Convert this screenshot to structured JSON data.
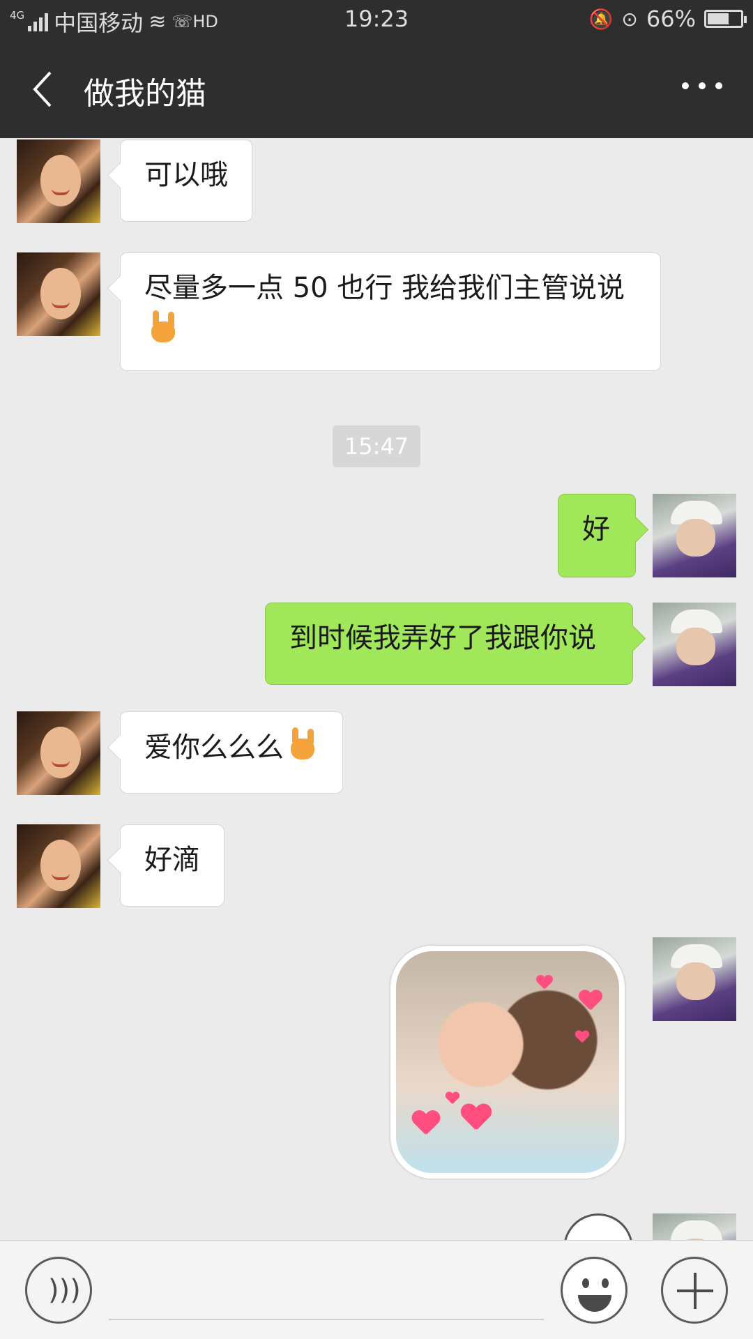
{
  "status_bar": {
    "network": "4G",
    "carrier": "中国移动",
    "call_badge": "HD",
    "time": "19:23",
    "battery": "66%",
    "battery_level": 0.66
  },
  "header": {
    "title": "做我的猫",
    "back_icon": "chevron-left-icon",
    "more_icon": "more-dots-icon"
  },
  "messages": [
    {
      "side": "left",
      "text": "可以哦"
    },
    {
      "side": "left",
      "text": "尽量多一点   50 也行 我给我们主管说说",
      "emoji": "rock-hand-emoji"
    },
    {
      "type": "timestamp",
      "text": "15:47"
    },
    {
      "side": "right",
      "text": "好"
    },
    {
      "side": "right",
      "text": "到时候我弄好了我跟你说"
    },
    {
      "side": "left",
      "text": "爱你么么么",
      "emoji": "rock-hand-emoji"
    },
    {
      "side": "left",
      "text": "好滴"
    },
    {
      "side": "right",
      "type": "sticker",
      "sticker": "kissing-kids-hearts-sticker"
    },
    {
      "side": "right",
      "type": "sticker",
      "sticker": "smiling-face-sticker-partial"
    }
  ],
  "input_bar": {
    "voice_icon": "voice-icon",
    "emoji_icon": "emoji-icon",
    "plus_icon": "plus-icon",
    "placeholder": ""
  },
  "colors": {
    "header_bg": "#2e2e2e",
    "chat_bg": "#ebebeb",
    "outgoing_bubble": "#a0e75a",
    "incoming_bubble": "#ffffff"
  }
}
